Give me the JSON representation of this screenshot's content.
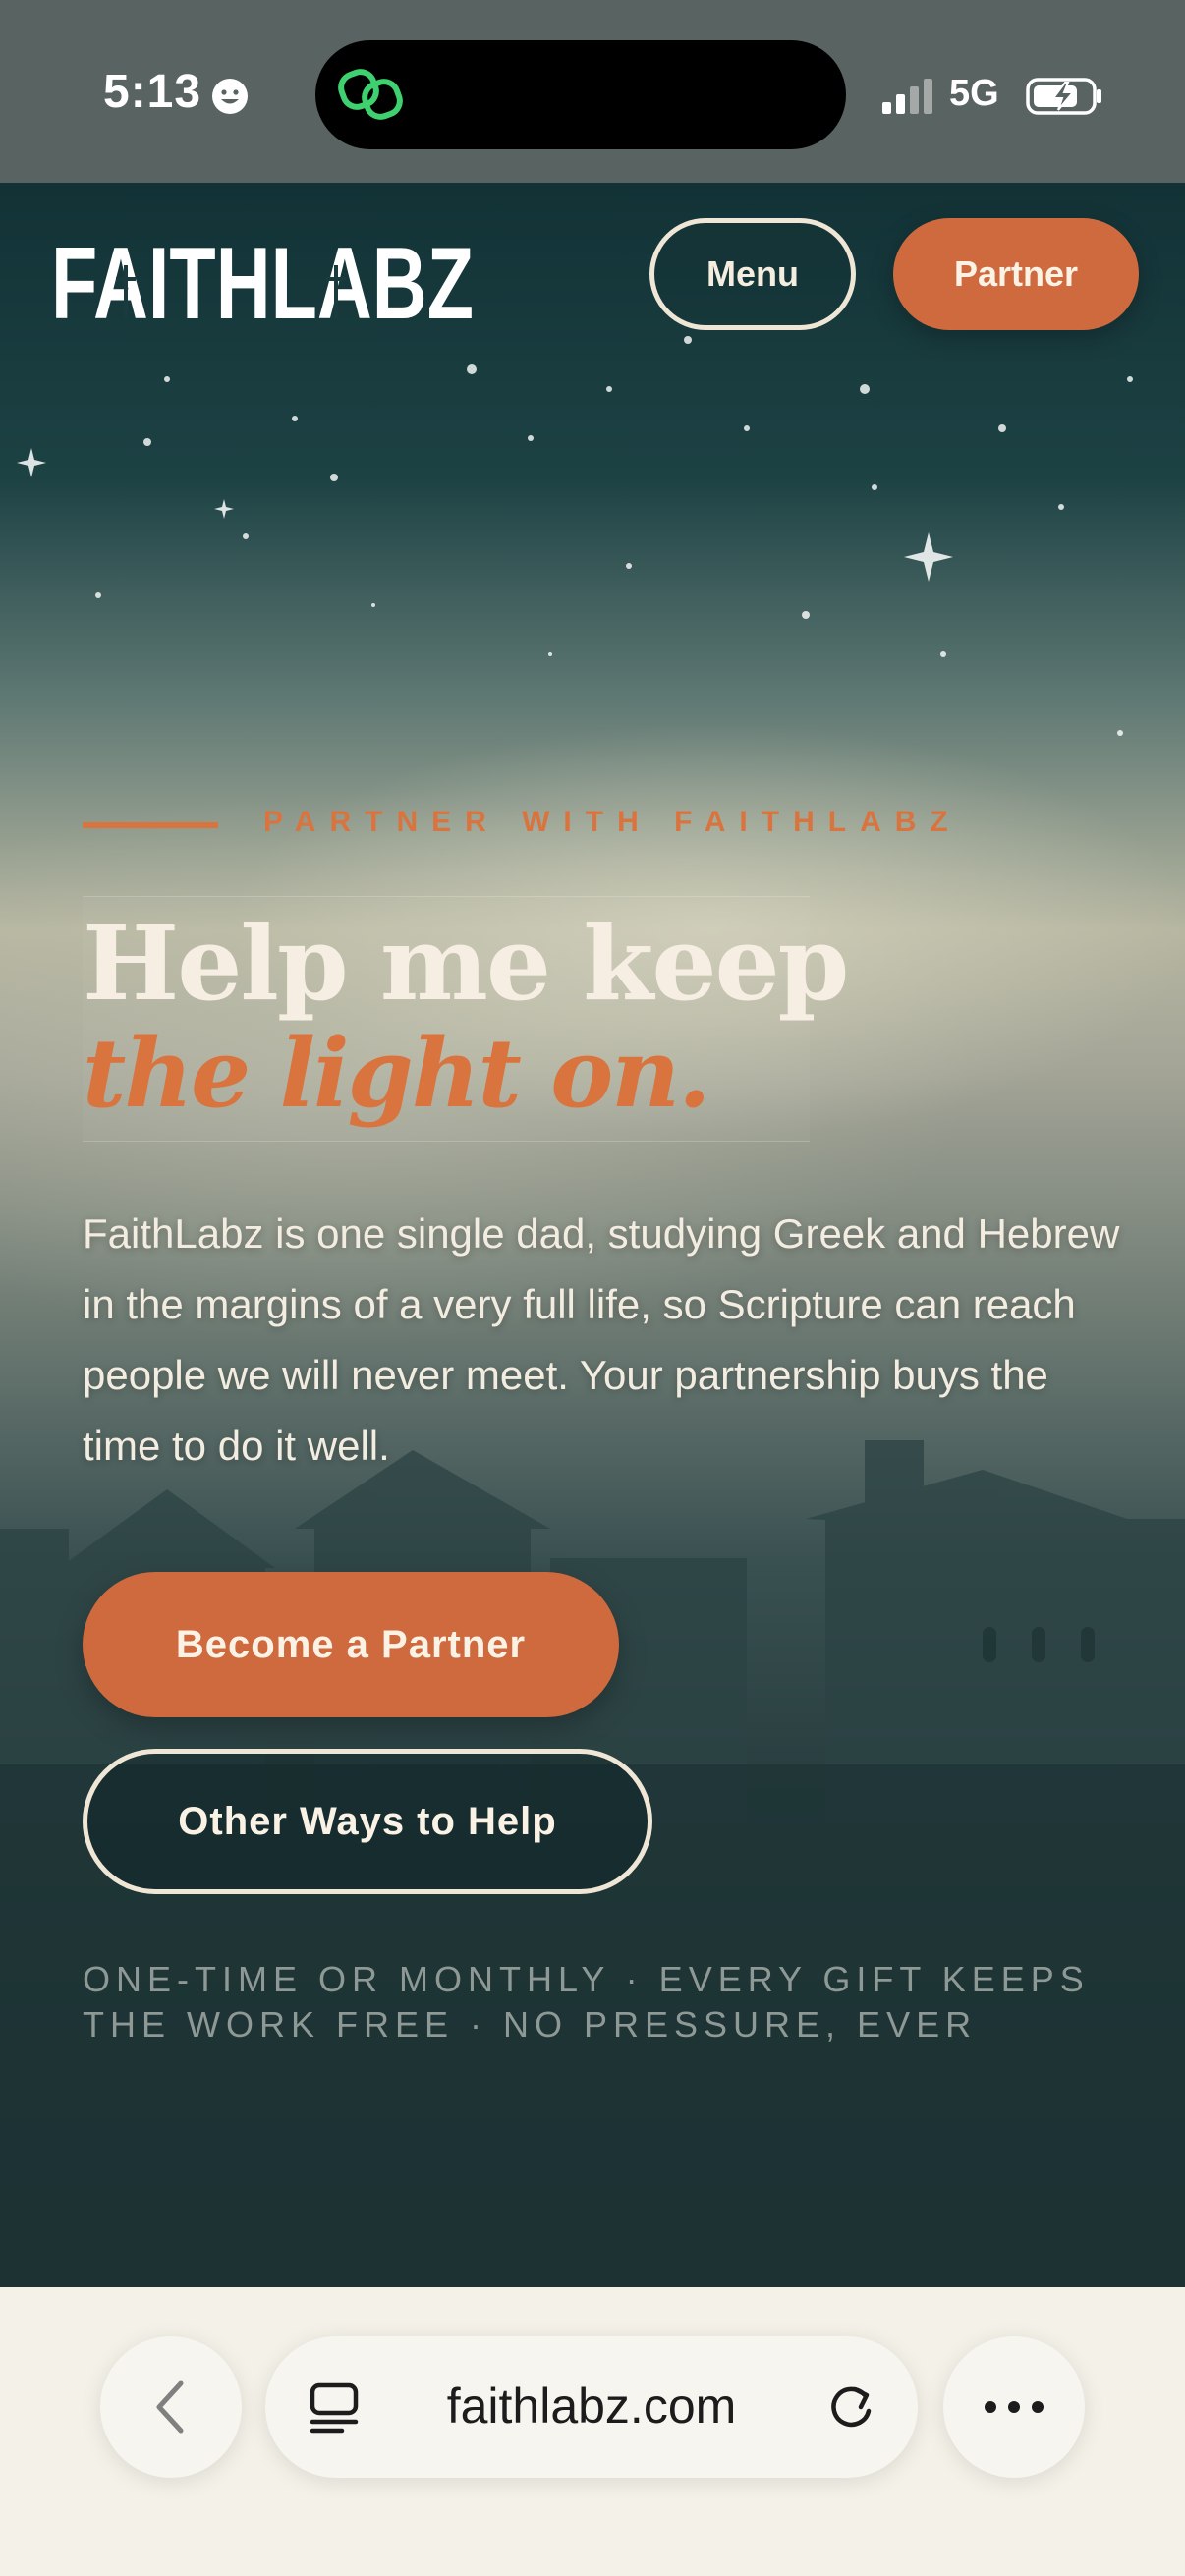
{
  "status_bar": {
    "time": "5:13",
    "network": "5G",
    "icons": [
      "face-icon",
      "link-icon",
      "signal-icon",
      "battery-charging-icon"
    ]
  },
  "nav": {
    "logo_text": "FAITHLABZ",
    "menu_label": "Menu",
    "partner_label": "Partner"
  },
  "hero": {
    "eyebrow": "PARTNER WITH FAITHLABZ",
    "headline_line1": "Help me keep",
    "headline_line2": "the light on.",
    "body": "FaithLabz is one single dad, studying Greek and Hebrew in the margins of a very full life, so Scripture can reach people we will never meet. Your partnership buys the time to do it well.",
    "primary_button": "Become a Partner",
    "secondary_button": "Other Ways to Help",
    "footnote": "ONE-TIME OR MONTHLY · EVERY GIFT KEEPS THE WORK FREE · NO PRESSURE, EVER"
  },
  "browser": {
    "url": "faithlabz.com",
    "icons": [
      "chevron-left-icon",
      "tabs-icon",
      "reload-icon",
      "more-icon"
    ]
  },
  "colors": {
    "accent": "#cf6a3f",
    "accent_text": "#d9743f",
    "cream": "#f6eee2",
    "status_bar": "#596362",
    "browser_bar": "#f4f1e8"
  }
}
